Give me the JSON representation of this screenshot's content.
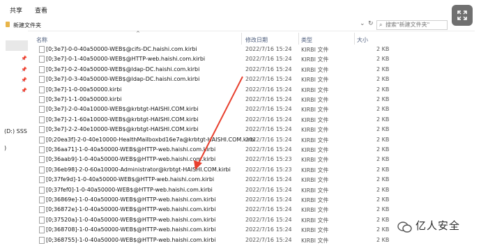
{
  "ribbon": {
    "tabs": [
      "共享",
      "查看"
    ]
  },
  "address": {
    "path": "新建文件夹",
    "dropdown_icon": "chevron-down-icon",
    "refresh_icon": "refresh-icon"
  },
  "search": {
    "placeholder": "搜索\"新建文件夹\""
  },
  "sidebar": {
    "drive_label": "(D:) SSS",
    "pins": [
      "pin-icon",
      "pin-icon",
      "pin-icon",
      "pin-icon",
      "pin-icon"
    ],
    "stub": ")"
  },
  "columns": {
    "name": "名称",
    "date": "修改日期",
    "type": "类型",
    "size": "大小"
  },
  "files": [
    {
      "name": "[0;3e7]-0-0-40a50000-WEB$@cifs-DC.haishi.com.kirbi",
      "date": "2022/7/16 15:24",
      "type": "KIRBI 文件",
      "size": "2 KB"
    },
    {
      "name": "[0;3e7]-0-1-40a50000-WEB$@HTTP-web.haishi.com.kirbi",
      "date": "2022/7/16 15:24",
      "type": "KIRBI 文件",
      "size": "2 KB"
    },
    {
      "name": "[0;3e7]-0-2-40a50000-WEB$@ldap-DC.haishi.com.kirbi",
      "date": "2022/7/16 15:24",
      "type": "KIRBI 文件",
      "size": "2 KB"
    },
    {
      "name": "[0;3e7]-0-3-40a50000-WEB$@ldap-DC.haishi.com.kirbi",
      "date": "2022/7/16 15:24",
      "type": "KIRBI 文件",
      "size": "2 KB"
    },
    {
      "name": "[0;3e7]-1-0-00a50000.kirbi",
      "date": "2022/7/16 15:24",
      "type": "KIRBI 文件",
      "size": "2 KB"
    },
    {
      "name": "[0;3e7]-1-1-00a50000.kirbi",
      "date": "2022/7/16 15:24",
      "type": "KIRBI 文件",
      "size": "2 KB"
    },
    {
      "name": "[0;3e7]-2-0-40a10000-WEB$@krbtgt-HAISHI.COM.kirbi",
      "date": "2022/7/16 15:24",
      "type": "KIRBI 文件",
      "size": "2 KB"
    },
    {
      "name": "[0;3e7]-2-1-60a10000-WEB$@krbtgt-HAISHI.COM.kirbi",
      "date": "2022/7/16 15:24",
      "type": "KIRBI 文件",
      "size": "2 KB"
    },
    {
      "name": "[0;3e7]-2-2-40e10000-WEB$@krbtgt-HAISHI.COM.kirbi",
      "date": "2022/7/16 15:24",
      "type": "KIRBI 文件",
      "size": "2 KB"
    },
    {
      "name": "[0;20ea3f]-2-0-40e10000-HealthMailboxbd16e7a@krbtgt-HAISHI.COM.kirbi",
      "date": "2022/7/16 15:24",
      "type": "KIRBI 文件",
      "size": "2 KB"
    },
    {
      "name": "[0;36aa71]-1-0-40a50000-WEB$@HTTP-web.haishi.com.kirbi",
      "date": "2022/7/16 15:24",
      "type": "KIRBI 文件",
      "size": "2 KB"
    },
    {
      "name": "[0;36aab9]-1-0-40a50000-WEB$@HTTP-web.haishi.com.kirbi",
      "date": "2022/7/16 15:23",
      "type": "KIRBI 文件",
      "size": "2 KB"
    },
    {
      "name": "[0;36eb98]-2-0-60a10000-Administrator@krbtgt-HAISHI.COM.kirbi",
      "date": "2022/7/16 15:23",
      "type": "KIRBI 文件",
      "size": "2 KB"
    },
    {
      "name": "[0;37fe9d]-1-0-40a50000-WEB$@HTTP-web.haishi.com.kirbi",
      "date": "2022/7/16 15:24",
      "type": "KIRBI 文件",
      "size": "2 KB"
    },
    {
      "name": "[0;37fef0]-1-0-40a50000-WEB$@HTTP-web.haishi.com.kirbi",
      "date": "2022/7/16 15:24",
      "type": "KIRBI 文件",
      "size": "2 KB"
    },
    {
      "name": "[0;36869e]-1-0-40a50000-WEB$@HTTP-web.haishi.com.kirbi",
      "date": "2022/7/16 15:24",
      "type": "KIRBI 文件",
      "size": "2 KB"
    },
    {
      "name": "[0;36872e]-1-0-40a50000-WEB$@HTTP-web.haishi.com.kirbi",
      "date": "2022/7/16 15:24",
      "type": "KIRBI 文件",
      "size": "2 KB"
    },
    {
      "name": "[0;37520a]-1-0-40a50000-WEB$@HTTP-web.haishi.com.kirbi",
      "date": "2022/7/16 15:24",
      "type": "KIRBI 文件",
      "size": "2 KB"
    },
    {
      "name": "[0;368708]-1-0-40a50000-WEB$@HTTP-web.haishi.com.kirbi",
      "date": "2022/7/16 15:24",
      "type": "KIRBI 文件",
      "size": "2 KB"
    },
    {
      "name": "[0;368755]-1-0-40a50000-WEB$@HTTP-web.haishi.com.kirbi",
      "date": "2022/7/16 15:24",
      "type": "KIRBI 文件",
      "size": "2 KB"
    }
  ],
  "annotation": {
    "color": "#e8402e",
    "target": "[0;36eb98]-2-0-60a10000-Administrator@krbtgt-HAISHI.COM.kirbi"
  },
  "watermark": {
    "text": "亿人安全",
    "icon": "wechat-icon"
  },
  "overlay": {
    "icon": "expand-icon"
  }
}
